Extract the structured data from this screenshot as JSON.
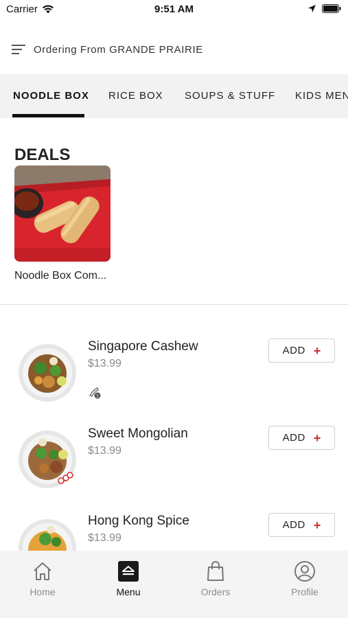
{
  "status_bar": {
    "carrier": "Carrier",
    "time": "9:51 AM"
  },
  "header": {
    "ordering_text": "Ordering From GRANDE PRAIRIE",
    "menu_icon": "hamburger-menu-icon"
  },
  "tabs": [
    {
      "label": "NOODLE BOX",
      "active": true
    },
    {
      "label": "RICE BOX",
      "active": false
    },
    {
      "label": "SOUPS & STUFF",
      "active": false
    },
    {
      "label": "KIDS MENU",
      "active": false
    }
  ],
  "deals": {
    "title": "DEALS",
    "items": [
      {
        "label": "Noodle Box Com..."
      }
    ]
  },
  "menu_items": [
    {
      "name": "Singapore Cashew",
      "price": "$13.99",
      "add_label": "ADD",
      "tag_icon": "spicy-level-icon"
    },
    {
      "name": "Sweet Mongolian",
      "price": "$13.99",
      "add_label": "ADD",
      "tag_icon": "dietary-badge-icon"
    },
    {
      "name": "Hong Kong Spice",
      "price": "$13.99",
      "add_label": "ADD"
    }
  ],
  "bottom_nav": [
    {
      "label": "Home",
      "icon": "home-icon",
      "active": false
    },
    {
      "label": "Menu",
      "icon": "menu-icon",
      "active": true
    },
    {
      "label": "Orders",
      "icon": "shopping-bag-icon",
      "active": false
    },
    {
      "label": "Profile",
      "icon": "profile-icon",
      "active": false
    }
  ],
  "colors": {
    "accent_red": "#d42b2b",
    "tab_bar_bg": "#f2f2f2",
    "nav_bg": "#f4f4f4"
  }
}
